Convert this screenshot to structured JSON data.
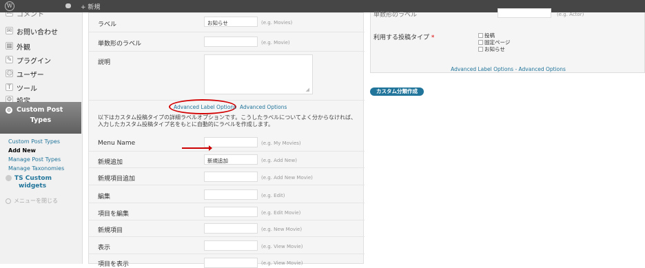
{
  "adminbar": {
    "logo": "W",
    "new_label": "新規"
  },
  "sidebar": {
    "items": [
      {
        "label": "コメント",
        "icon": "comment-icon"
      },
      {
        "label": "お問い合わせ",
        "icon": "mail-icon"
      },
      {
        "label": "外観",
        "icon": "appearance-icon"
      },
      {
        "label": "プラグイン",
        "icon": "plugin-icon"
      },
      {
        "label": "ユーザー",
        "icon": "users-icon"
      },
      {
        "label": "ツール",
        "icon": "tools-icon"
      },
      {
        "label": "設定",
        "icon": "settings-icon"
      }
    ],
    "cpt_line1": "Custom Post",
    "cpt_line2": "Types",
    "submenu": [
      "Custom Post Types",
      "Add New",
      "Manage Post Types",
      "Manage Taxonomies"
    ],
    "ts_line1": "TS Custom",
    "ts_line2": "widgets",
    "collapse": "メニューを閉じる"
  },
  "form": {
    "label_row": {
      "label": "ラベル",
      "value": "お知らせ",
      "hint": "(e.g. Movies)"
    },
    "singular_row": {
      "label": "単数形のラベル",
      "value": "",
      "hint": "(e.g. Movie)"
    },
    "desc_label": "説明",
    "link_advanced_label": "Advanced Label Options",
    "link_advanced": "Advanced Options",
    "description": "以下はカスタム投稿タイプの詳細ラベルオプションです。こうしたラベルについてよく分からなければ、入力したカスタム投稿タイプ名をもとに自動的にラベルを作成します。",
    "rows": [
      {
        "label": "Menu Name",
        "value": "",
        "hint": "(e.g. My Movies)"
      },
      {
        "label": "新規追加",
        "value": "新規追加",
        "hint": "(e.g. Add New)"
      },
      {
        "label": "新規項目追加",
        "value": "",
        "hint": "(e.g. Add New Movie)"
      },
      {
        "label": "編集",
        "value": "",
        "hint": "(e.g. Edit)"
      },
      {
        "label": "項目を編集",
        "value": "",
        "hint": "(e.g. Edit Movie)"
      },
      {
        "label": "新規項目",
        "value": "",
        "hint": "(e.g. New Movie)"
      },
      {
        "label": "表示",
        "value": "",
        "hint": "(e.g. View Movie)"
      },
      {
        "label": "項目を表示",
        "value": "",
        "hint": "(e.g. View Movie)"
      }
    ]
  },
  "right": {
    "singular_label": "単数形のラベル",
    "singular_hint": "(e.g. Actor)",
    "post_type_label": "利用する投稿タイプ",
    "required_mark": "*",
    "post_types": [
      "投稿",
      "固定ページ",
      "お知らせ"
    ],
    "advanced_links": "Advanced Label Options - Advanced Options",
    "create_button": "カスタム分類作成"
  }
}
